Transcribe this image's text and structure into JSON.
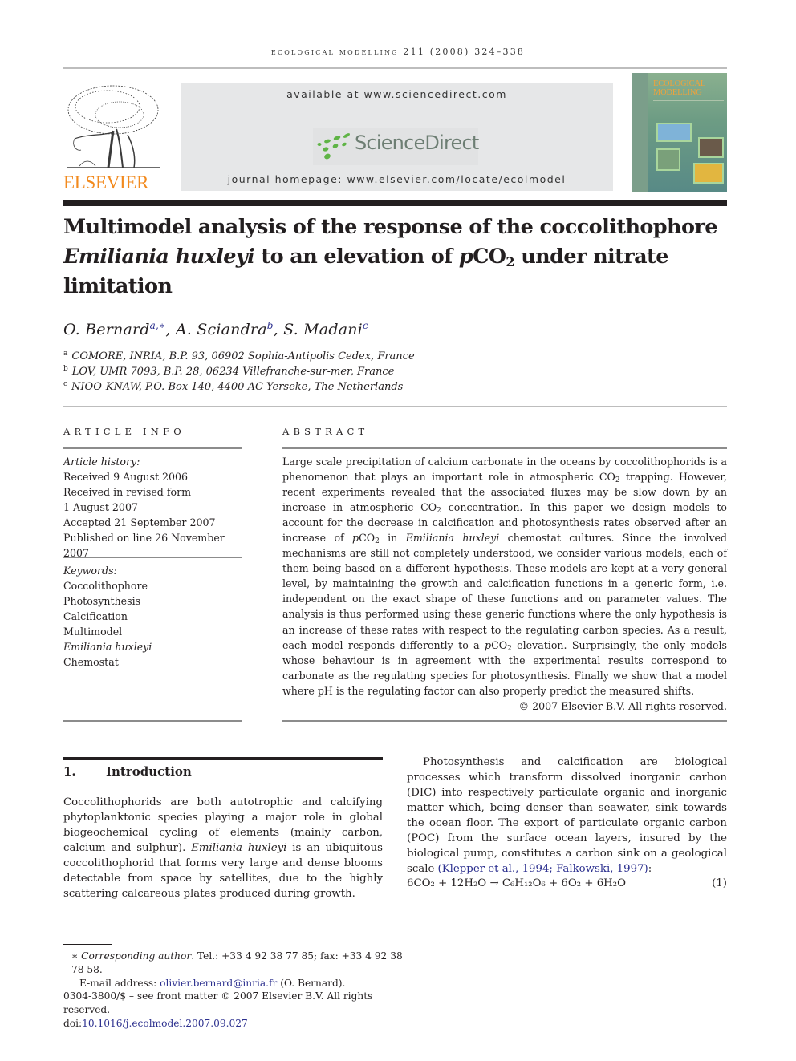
{
  "running_head": "ecological modelling 211 (2008) 324–338",
  "header": {
    "publisher_logo_text": "ELSEVIER",
    "available_at": "available at www.sciencedirect.com",
    "sciencedirect_logo_text": "ScienceDirect",
    "journal_homepage": "journal homepage: www.elsevier.com/locate/ecolmodel",
    "cover": {
      "title_line1": "ECOLOGICAL",
      "title_line2": "MODELLING"
    },
    "colors": {
      "elsevier_orange": "#f28a1e",
      "sciencedirect_green": "#5fb446",
      "sciencedirect_text": "#6d7e73",
      "banner_bg": "#e6e7e8",
      "link_blue": "#2b2f8e"
    }
  },
  "article": {
    "title": {
      "line1": "Multimodel analysis of the response of the coccolithophore",
      "line2_italic": "Emiliania huxleyi",
      "line2_mid": " to an elevation of ",
      "line2_p": "p",
      "line2_co": "CO",
      "line2_sub": "2",
      "line2_end": " under nitrate",
      "line3": "limitation"
    },
    "authors": [
      {
        "name": "O. Bernard",
        "marks": "a,∗"
      },
      {
        "name": "A. Sciandra",
        "marks": "b"
      },
      {
        "name": "S. Madani",
        "marks": "c"
      }
    ],
    "affiliations": [
      {
        "mark": "a",
        "text": "COMORE, INRIA, B.P. 93, 06902 Sophia-Antipolis Cedex, France"
      },
      {
        "mark": "b",
        "text": "LOV, UMR 7093, B.P. 28, 06234 Villefranche-sur-mer, France"
      },
      {
        "mark": "c",
        "text": "NIOO-KNAW, P.O. Box 140, 4400 AC Yerseke, The Netherlands"
      }
    ]
  },
  "article_info": {
    "heading": "article info",
    "history_label": "Article history:",
    "history": [
      "Received 9 August 2006",
      "Received in revised form",
      "1 August 2007",
      "Accepted 21 September 2007",
      "Published on line 26 November 2007"
    ],
    "keywords_label": "Keywords:",
    "keywords": [
      {
        "text": "Coccolithophore",
        "italic": false
      },
      {
        "text": "Photosynthesis",
        "italic": false
      },
      {
        "text": "Calcification",
        "italic": false
      },
      {
        "text": "Multimodel",
        "italic": false
      },
      {
        "text": "Emiliania huxleyi",
        "italic": true
      },
      {
        "text": "Chemostat",
        "italic": false
      }
    ]
  },
  "abstract": {
    "heading": "abstract",
    "p1": "Large scale precipitation of calcium carbonate in the oceans by coccolithophorids is a phenomenon that plays an important role in atmospheric CO",
    "p2": " trapping. However, recent experiments revealed that the associated fluxes may be slow down by an increase in atmospheric CO",
    "p3": " concentration. In this paper we design models to account for the decrease in calcification and photosynthesis rates observed after an increase of ",
    "p4": " in ",
    "species": "Emiliania huxleyi",
    "p5": " chemostat cultures. Since the involved mechanisms are still not completely understood, we consider various models, each of them being based on a different hypothesis. These models are kept at a very general level, by maintaining the growth and calcification functions in a generic form, i.e. independent on the exact shape of these functions and on parameter values. The analysis is thus performed using these generic functions where the only hypothesis is an increase of these rates with respect to the regulating carbon species. As a result, each model responds differently to a ",
    "p6": " elevation. Surprisingly, the only models whose behaviour is in agreement with the experimental results correspond to carbonate as the regulating species for photosynthesis. Finally we show that a model where pH is the regulating factor can also properly predict the measured shifts.",
    "pco2_p": "p",
    "pco2_co": "CO",
    "sub2": "2",
    "copyright": "© 2007 Elsevier B.V. All rights reserved."
  },
  "introduction": {
    "number": "1.",
    "heading": "Introduction",
    "para1_a": "Coccolithophorids are both autotrophic and calcifying phytoplanktonic species playing a major role in global biogeochemical cycling of elements (mainly carbon, calcium and sulphur). ",
    "para1_species": "Emiliania huxleyi",
    "para1_b": " is an ubiquitous coccolithophorid that forms very large and dense blooms detectable from space by satellites, due to the highly scattering calcareous plates produced during growth.",
    "para2_a": "Photosynthesis and calcification are biological processes which transform dissolved inorganic carbon (DIC) into respectively particulate organic and inorganic matter which, being denser than seawater, sink towards the ocean floor. The export of particulate organic carbon (POC) from the surface ocean layers, insured by the biological pump, constitutes a carbon sink on a geological scale ",
    "para2_ref": "(Klepper et al., 1994; Falkowski, 1997)",
    "para2_end": ":",
    "equation": {
      "lhs": "6CO₂ + 12H₂O",
      "arrow": "→",
      "rhs": "C₆H₁₂O₆ + 6O₂ + 6H₂O",
      "number": "(1)"
    }
  },
  "footnotes": {
    "star": "∗",
    "corresponding_label": "Corresponding author",
    "corresponding_rest": ". Tel.: +33 4 92 38 77 85; fax: +33 4 92 38 78 58.",
    "email_label": "E-mail address: ",
    "email": "olivier.bernard@inria.fr",
    "email_owner": " (O. Bernard).",
    "issn": "0304-3800/$ – see front matter © 2007 Elsevier B.V. All rights reserved.",
    "doi_label": "doi:",
    "doi": "10.1016/j.ecolmodel.2007.09.027"
  }
}
